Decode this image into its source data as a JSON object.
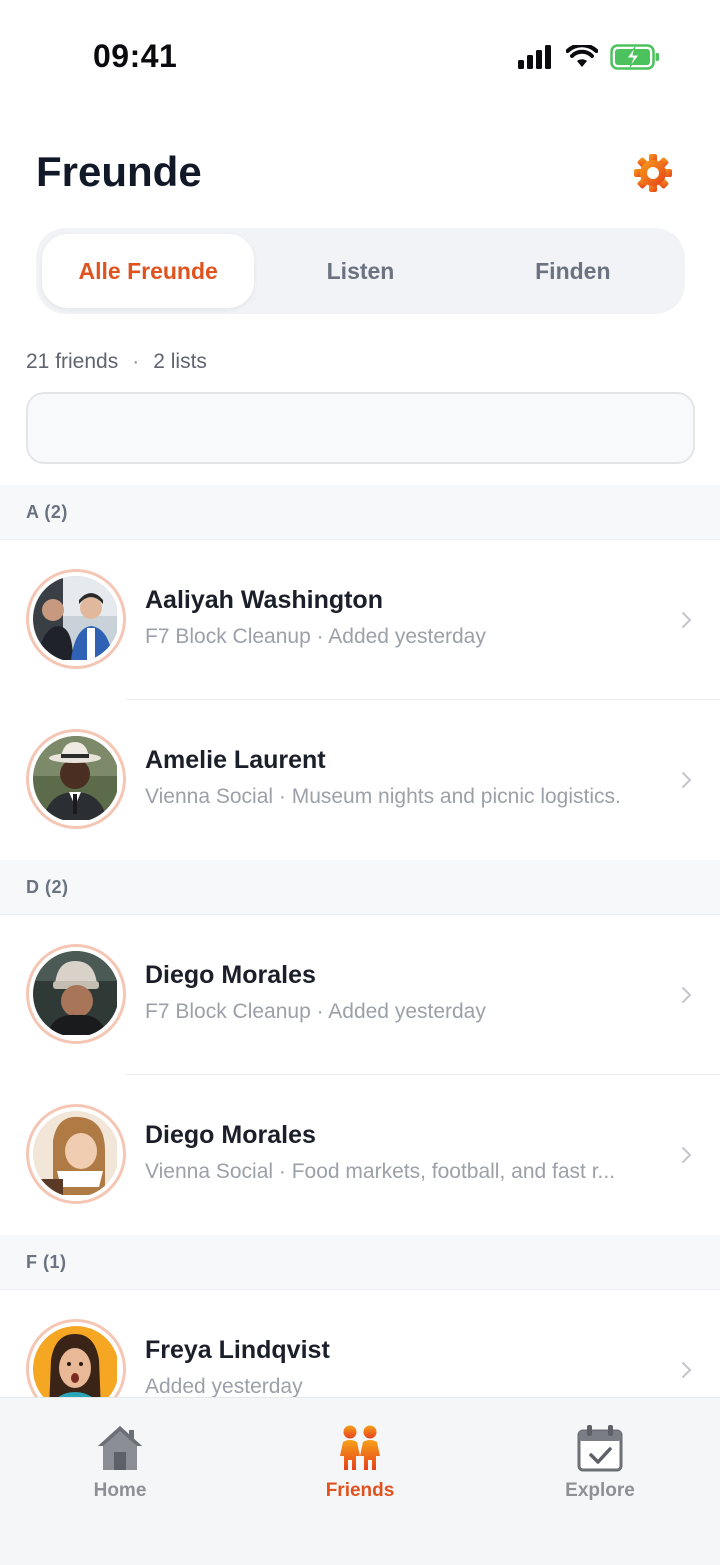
{
  "status_bar": {
    "time": "09:41"
  },
  "header": {
    "title": "Freunde"
  },
  "segments": [
    {
      "label": "Alle Freunde",
      "active": true
    },
    {
      "label": "Listen",
      "active": false
    },
    {
      "label": "Finden",
      "active": false
    }
  ],
  "summary": {
    "friends": "21 friends",
    "separator": "·",
    "lists": "2 lists"
  },
  "search": {
    "value": "",
    "placeholder": ""
  },
  "sections": [
    {
      "header": "A (2)",
      "rows": [
        {
          "name": "Aaliyah Washington",
          "subtitle": "F7 Block Cleanup · Added yesterday",
          "avatar": "photo-two-men-office"
        },
        {
          "name": "Amelie Laurent",
          "subtitle": "Vienna Social · Museum nights and picnic logistics.",
          "avatar": "photo-man-hat"
        }
      ]
    },
    {
      "header": "D (2)",
      "rows": [
        {
          "name": "Diego Morales",
          "subtitle": "F7 Block Cleanup · Added yesterday",
          "avatar": "photo-woman-beanie"
        },
        {
          "name": "Diego Morales",
          "subtitle": "Vienna Social · Food markets, football, and fast r...",
          "avatar": "photo-woman-coffee"
        }
      ]
    },
    {
      "header": "F (1)",
      "rows": [
        {
          "name": "Freya Lindqvist",
          "subtitle": "Added yesterday",
          "avatar": "photo-girl-surprised"
        }
      ]
    }
  ],
  "tab_bar": [
    {
      "label": "Home",
      "icon": "house-icon",
      "active": false
    },
    {
      "label": "Friends",
      "icon": "people-icon",
      "active": true
    },
    {
      "label": "Explore",
      "icon": "calendar-check-icon",
      "active": false
    }
  ],
  "colors": {
    "accent": "#e0531f",
    "muted_text": "#9ca0a8",
    "section_bg": "#f6f8fa"
  }
}
